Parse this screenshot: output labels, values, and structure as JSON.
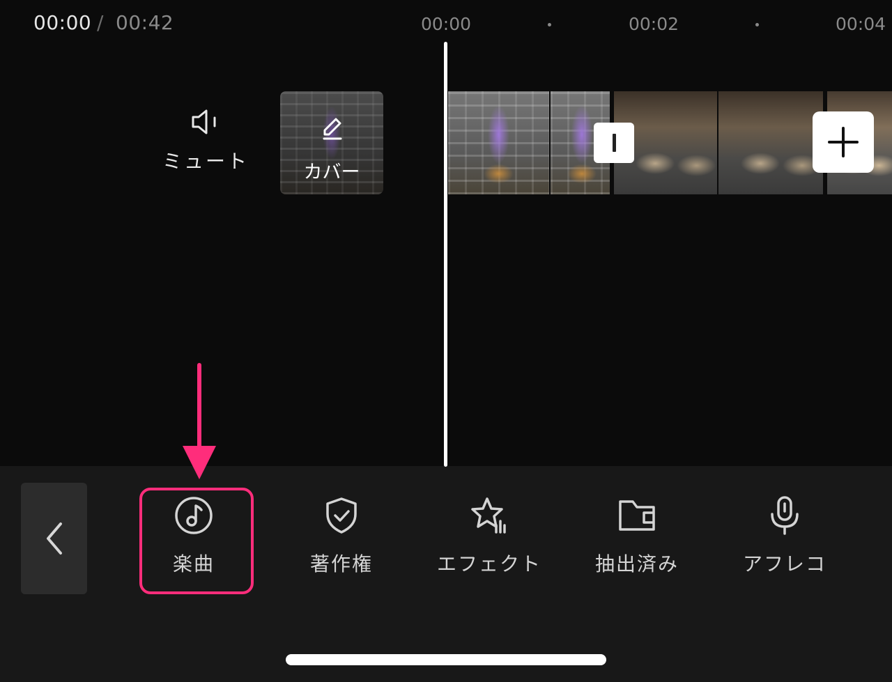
{
  "header": {
    "current_time": "00:00",
    "separator": "/",
    "total_time": "00:42",
    "ticks": [
      "00:00",
      "00:02",
      "00:04"
    ]
  },
  "track": {
    "mute_label": "ミュート",
    "cover_label": "カバー"
  },
  "toolbar": {
    "items": [
      {
        "label": "楽曲",
        "icon": "music-note-icon",
        "highlighted": true
      },
      {
        "label": "著作権",
        "icon": "shield-check-icon"
      },
      {
        "label": "エフェクト",
        "icon": "star-sparkle-icon"
      },
      {
        "label": "抽出済み",
        "icon": "folder-icon"
      },
      {
        "label": "アフレコ",
        "icon": "microphone-icon"
      }
    ]
  },
  "colors": {
    "highlight": "#ff2d7b",
    "background": "#0b0b0b",
    "panel": "#181818"
  }
}
